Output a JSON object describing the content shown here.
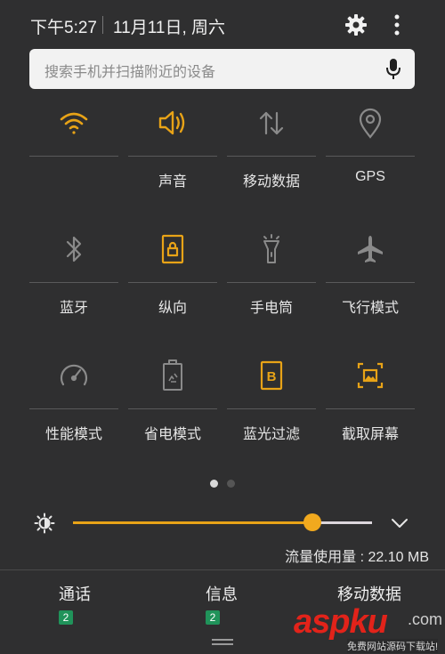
{
  "status_bar": {
    "time": "下午5:27",
    "date": "11月11日, 周六"
  },
  "search": {
    "placeholder": "搜索手机并扫描附近的设备"
  },
  "colors": {
    "active": "#e8a317",
    "inactive": "#8a8a8a",
    "background": "#2f2f30",
    "badge": "#20935a"
  },
  "tiles": [
    {
      "label": "",
      "icon": "wifi-icon",
      "active": true
    },
    {
      "label": "声音",
      "icon": "volume-icon",
      "active": true
    },
    {
      "label": "移动数据",
      "icon": "mobile-data-icon",
      "active": false
    },
    {
      "label": "GPS",
      "icon": "location-pin-icon",
      "active": false
    },
    {
      "label": "蓝牙",
      "icon": "bluetooth-icon",
      "active": false
    },
    {
      "label": "纵向",
      "icon": "portrait-lock-icon",
      "active": true
    },
    {
      "label": "手电筒",
      "icon": "flashlight-icon",
      "active": false
    },
    {
      "label": "飞行模式",
      "icon": "airplane-icon",
      "active": false
    },
    {
      "label": "性能模式",
      "icon": "speedometer-icon",
      "active": false
    },
    {
      "label": "省电模式",
      "icon": "battery-saver-icon",
      "active": false
    },
    {
      "label": "蓝光过滤",
      "icon": "blue-light-filter-icon",
      "active": true
    },
    {
      "label": "截取屏幕",
      "icon": "screenshot-icon",
      "active": true
    }
  ],
  "pager": {
    "current": 1,
    "total": 2
  },
  "brightness": {
    "level": 0.8,
    "icon": "brightness-icon"
  },
  "data_usage": "流量使用量 : 22.10 MB",
  "notifications": [
    {
      "title": "通话",
      "count": "2"
    },
    {
      "title": "信息",
      "count": "2"
    },
    {
      "title": "移动数据",
      "count": ""
    }
  ],
  "watermark": {
    "main": "aspku",
    "tld": ".com",
    "sub": "免费网站源码下载站!"
  }
}
